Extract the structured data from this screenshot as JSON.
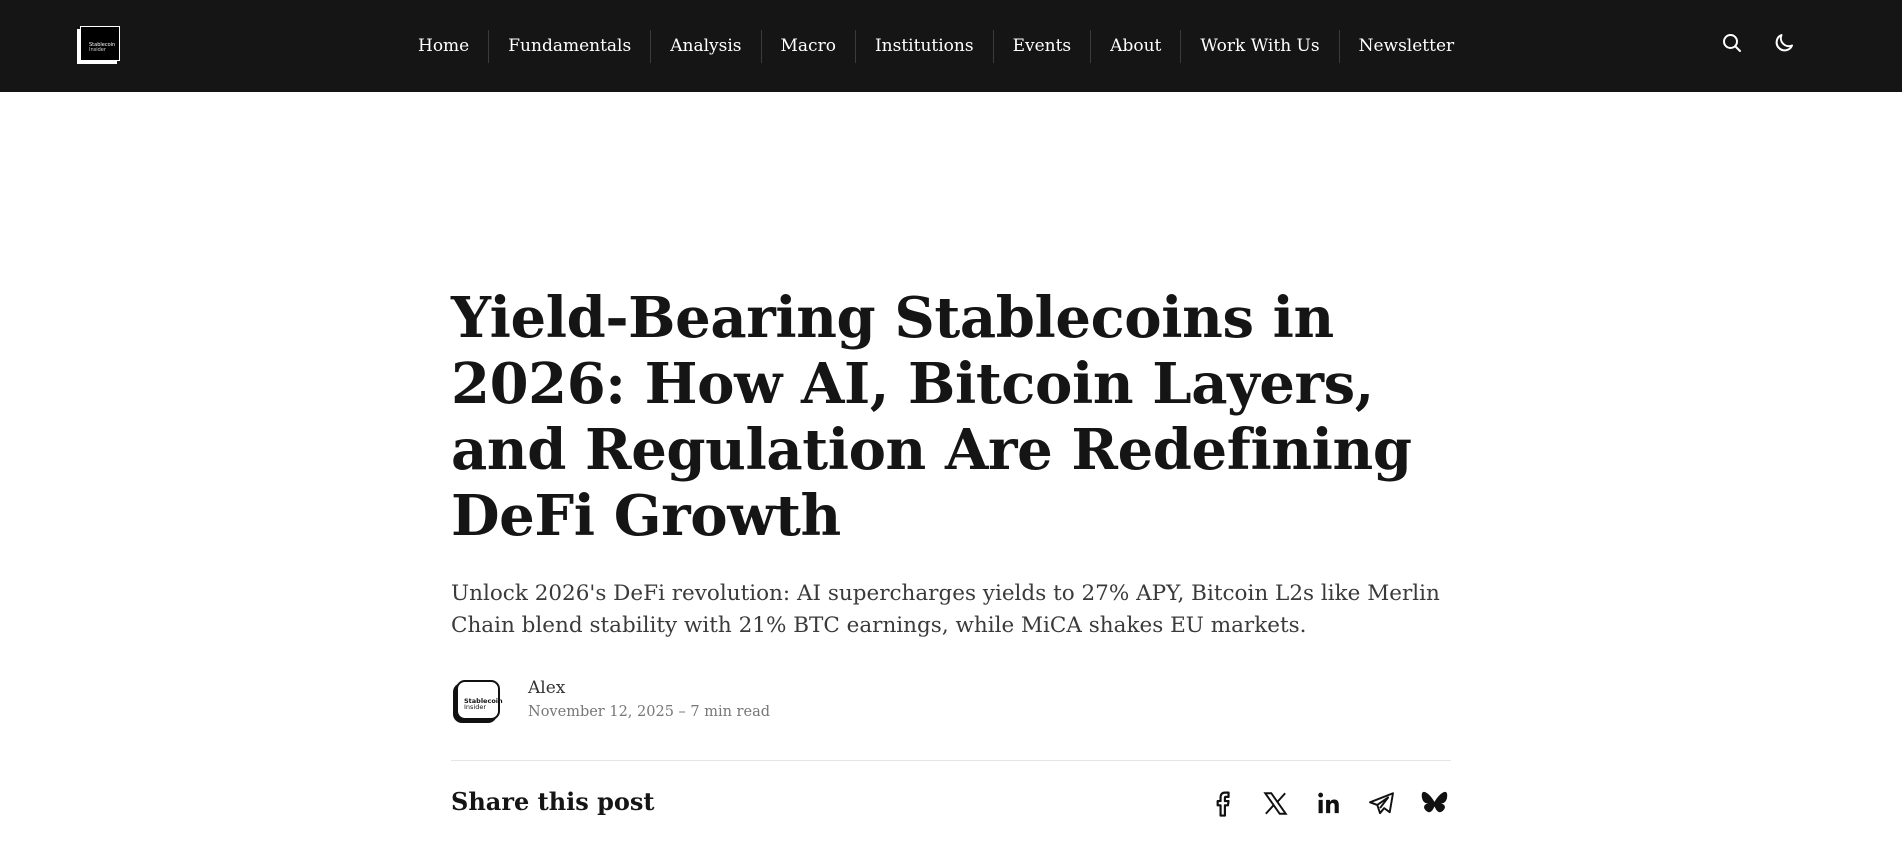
{
  "brand": {
    "name": "Stablecoin",
    "sub": "Insider"
  },
  "nav": {
    "items": [
      {
        "label": "Home"
      },
      {
        "label": "Fundamentals"
      },
      {
        "label": "Analysis"
      },
      {
        "label": "Macro"
      },
      {
        "label": "Institutions"
      },
      {
        "label": "Events"
      },
      {
        "label": "About"
      },
      {
        "label": "Work With Us"
      },
      {
        "label": "Newsletter"
      }
    ]
  },
  "toolbar": {
    "search_icon": "search-icon",
    "theme_icon": "moon-icon"
  },
  "article": {
    "title": "Yield-Bearing Stablecoins in 2026: How AI, Bitcoin Layers, and Regulation Are Redefining DeFi Growth",
    "excerpt": "Unlock 2026's DeFi revolution: AI supercharges yields to 27% APY, Bitcoin L2s like Merlin Chain blend stability with 21% BTC earnings, while MiCA shakes EU markets.",
    "author": "Alex",
    "meta": "November 12, 2025 – 7 min read"
  },
  "share": {
    "title": "Share this post",
    "icons": [
      "facebook-icon",
      "x-icon",
      "linkedin-icon",
      "telegram-icon",
      "bluesky-icon"
    ]
  },
  "colors": {
    "header_bg": "#151515",
    "text": "#151515",
    "muted": "#777777"
  }
}
